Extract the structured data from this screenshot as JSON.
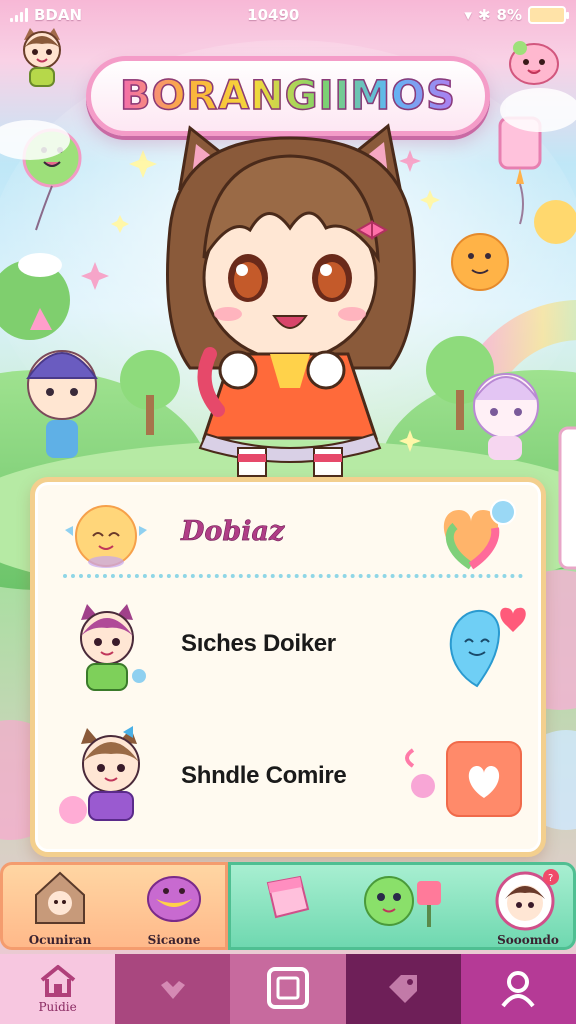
{
  "status_bar": {
    "carrier": "BDAN",
    "time": "10490",
    "battery": "8%"
  },
  "title": "BORANGIIMOS",
  "panel": {
    "title": "Dobiaz",
    "rows": [
      {
        "name": "Sıches Doiker"
      },
      {
        "name": "Shndle Comire"
      }
    ]
  },
  "categories": [
    {
      "label": "Ocuniran"
    },
    {
      "label": "Sicaone"
    },
    {
      "label": ""
    },
    {
      "label": ""
    },
    {
      "label": "Sooomdo"
    }
  ],
  "nav": [
    {
      "label": "Puidie",
      "icon": "home-icon"
    },
    {
      "label": "",
      "icon": "heart-down-icon"
    },
    {
      "label": "",
      "icon": "square-frame-icon"
    },
    {
      "label": "",
      "icon": "tag-icon"
    },
    {
      "label": "",
      "icon": "profile-icon"
    }
  ],
  "colors": {
    "panel_border": "#f3cf8e",
    "title_accent": "#b03d86",
    "nav_active": "#f7c7e0",
    "nav_dark": "#6e1f58"
  }
}
